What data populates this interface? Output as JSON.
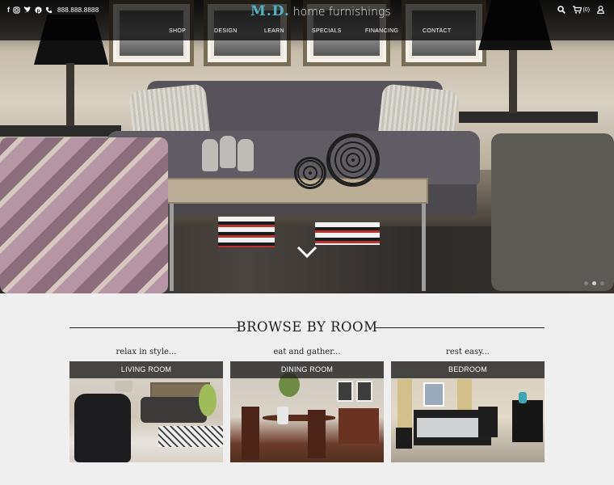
{
  "header": {
    "phone": "888.888.8888",
    "logo_primary": "M.D.",
    "logo_secondary": "home furnishings",
    "cart_count": "(0)",
    "nav": [
      "SHOP",
      "DESIGN",
      "LEARN",
      "SPECIALS",
      "FINANCING",
      "CONTACT"
    ],
    "social_icons": [
      "facebook-icon",
      "instagram-icon",
      "twitter-icon",
      "pinterest-icon",
      "phone-icon"
    ]
  },
  "hero": {
    "slides": 3,
    "active_slide": 2
  },
  "browse": {
    "title": "BROWSE BY ROOM",
    "rooms": [
      {
        "tagline": "relax in style...",
        "label": "LIVING ROOM"
      },
      {
        "tagline": "eat and gather...",
        "label": "DINING ROOM"
      },
      {
        "tagline": "rest easy...",
        "label": "BEDROOM"
      }
    ]
  },
  "colors": {
    "accent": "#4fb3c4",
    "topbar": "#000000",
    "page_background": "#efefef"
  }
}
